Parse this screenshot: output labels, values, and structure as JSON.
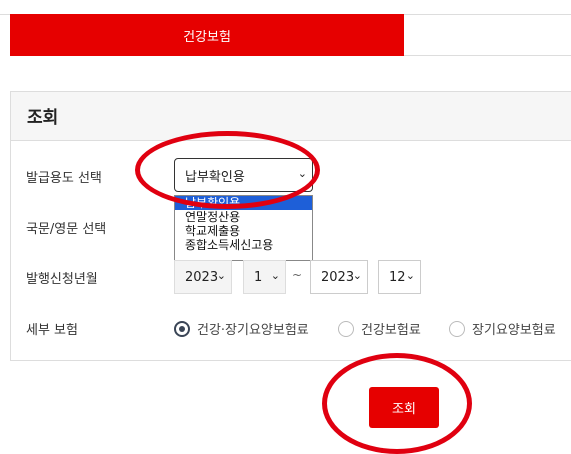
{
  "tabs": {
    "active_label": "건강보험"
  },
  "panel": {
    "title": "조회"
  },
  "rows": {
    "purpose_label": "발급용도 선택",
    "language_label": "국문/영문 선택",
    "period_label": "발행신청년월",
    "detail_label": "세부 보험"
  },
  "purpose_select": {
    "value": "납부확인용",
    "options": [
      "납부확인용",
      "연말정산용",
      "학교제출용",
      "종합소득세신고용"
    ]
  },
  "period": {
    "from_year": "2023",
    "from_month": "1",
    "separator": "~",
    "to_year": "2023",
    "to_month": "12"
  },
  "detail_options": {
    "opt1": "건강·장기요양보험료",
    "opt2": "건강보험료",
    "opt3": "장기요양보험료",
    "selected": "건강·장기요양보험료"
  },
  "search_button": {
    "label": "조회"
  },
  "annotation_color": "#e00010",
  "accent_color": "#e60000",
  "icons": {
    "select_arrow": "chevron-down-icon"
  }
}
